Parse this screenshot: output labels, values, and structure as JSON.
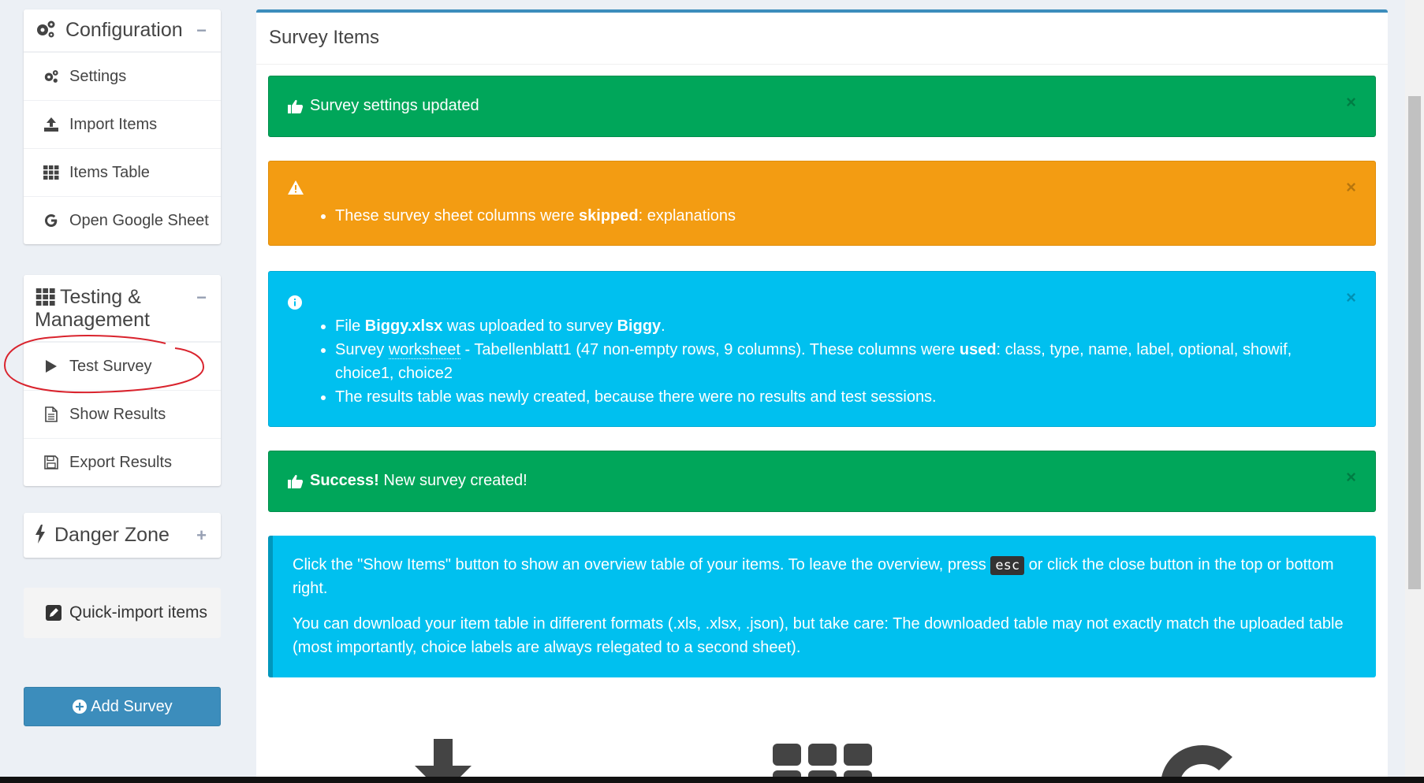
{
  "sidebar": {
    "configuration": {
      "title": "Configuration",
      "toggle": "−",
      "items": [
        "Settings",
        "Import Items",
        "Items Table",
        "Open Google Sheet"
      ]
    },
    "testing": {
      "title": "Testing & Management",
      "toggle": "−",
      "items": [
        "Test Survey",
        "Show Results",
        "Export Results"
      ]
    },
    "danger": {
      "title": "Danger Zone",
      "toggle": "+"
    },
    "quick_import": "Quick-import items",
    "add_survey": "Add Survey"
  },
  "main": {
    "title": "Survey Items",
    "alerts": {
      "settings_updated": "Survey settings updated",
      "skipped": {
        "prefix": "These survey sheet columns were ",
        "bold": "skipped",
        "suffix": ": explanations"
      },
      "upload": {
        "li1_a": "File ",
        "li1_file": "Biggy.xlsx",
        "li1_b": " was uploaded to survey ",
        "li1_survey": "Biggy",
        "li1_c": ".",
        "li2_a": "Survey ",
        "li2_link": "worksheet",
        "li2_b": " - Tabellenblatt1 (47 non-empty rows, 9 columns). These columns were ",
        "li2_used": "used",
        "li2_c": ": class, type, name, label, optional, showif, choice1, choice2",
        "li3": "The results table was newly created, because there were no results and test sessions."
      },
      "success": {
        "bold": "Success!",
        "text": " New survey created!"
      }
    },
    "callout": {
      "p1_a": "Click the \"Show Items\" button to show an overview table of your items. To leave the overview, press ",
      "p1_key": "esc",
      "p1_b": " or click the close button in the top or bottom right.",
      "p2": "You can download your item table in different formats (.xls, .xlsx, .json), but take care: The downloaded table may not exactly match the uploaded table (most importantly, choice labels are always relegated to a second sheet)."
    },
    "close_symbol": "×"
  },
  "colors": {
    "success": "#00a65a",
    "warning": "#f39c12",
    "info": "#00c0ef",
    "primary": "#3c8dbc",
    "annotation": "#d9232d"
  }
}
